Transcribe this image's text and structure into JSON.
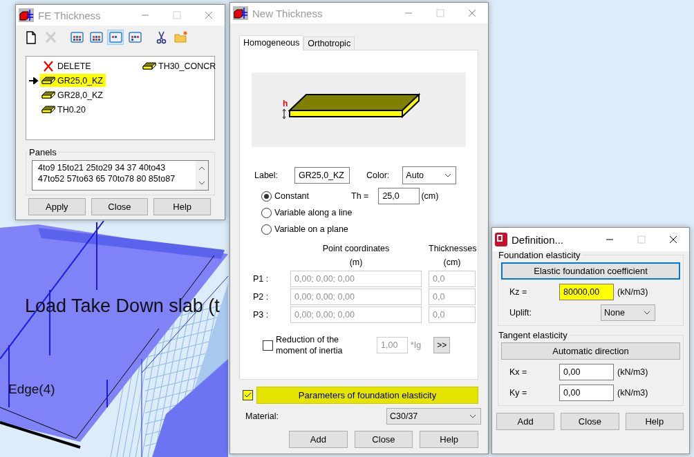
{
  "viewport": {
    "labels": [
      {
        "text": "Load Take Down slab (t",
        "kind": "large"
      },
      {
        "text": "Edge(4)",
        "kind": "small"
      }
    ]
  },
  "fe_thickness": {
    "title": "FE Thickness",
    "active": false,
    "toolbar": [
      {
        "kind": "new",
        "disabled": false,
        "selected": false
      },
      {
        "kind": "delete",
        "disabled": true,
        "selected": false
      },
      {
        "kind": "view",
        "disabled": false,
        "selected": false
      },
      {
        "kind": "view",
        "disabled": false,
        "selected": false
      },
      {
        "kind": "view",
        "disabled": false,
        "selected": true
      },
      {
        "kind": "view",
        "disabled": false,
        "selected": false
      },
      {
        "kind": "cut",
        "disabled": false,
        "selected": false
      },
      {
        "kind": "open",
        "disabled": false,
        "selected": false
      }
    ],
    "items": [
      {
        "label": "DELETE",
        "kind": "delete",
        "selected": false,
        "highlighted": false
      },
      {
        "label": "GR25,0_KZ",
        "kind": "thickness",
        "selected": true,
        "highlighted": true
      },
      {
        "label": "GR28,0_KZ",
        "kind": "thickness",
        "selected": false,
        "highlighted": false
      },
      {
        "label": "TH0.20",
        "kind": "thickness",
        "selected": false,
        "highlighted": false
      },
      {
        "label": "TH30_CONCR",
        "kind": "thickness",
        "selected": false,
        "highlighted": false
      }
    ],
    "panels": {
      "title": "Panels",
      "lines": [
        "4to9 15to21 25to29 34 37 40to43",
        "47to52 57to63 65 70to78 80 85to87"
      ]
    },
    "buttons": [
      "Apply",
      "Close",
      "Help"
    ]
  },
  "new_thickness": {
    "title": "New Thickness",
    "active": false,
    "tabs": [
      {
        "label": "Homogeneous",
        "selected": true
      },
      {
        "label": "Orthotropic",
        "selected": false
      }
    ],
    "preview": {
      "dimension_label": "h"
    },
    "label_field": {
      "label": "Label:",
      "value": "GR25,0_KZ"
    },
    "color_select": {
      "label": "Color:",
      "value": "Auto"
    },
    "modes": [
      {
        "label": "Constant",
        "selected": true
      },
      {
        "label": "Variable along a line",
        "selected": false
      },
      {
        "label": "Variable on a plane",
        "selected": false
      }
    ],
    "thickness_field": {
      "label": "Th =",
      "value": "25,0",
      "unit": "(cm)"
    },
    "points": {
      "disabled": true,
      "headers": [
        {
          "title": "Point coordinates",
          "unit": "(m)"
        },
        {
          "title": "Thicknesses",
          "unit": "(cm)"
        }
      ],
      "rows": [
        {
          "label": "P1 :",
          "coordinates": "0,00; 0,00; 0,00",
          "thickness": "0,0"
        },
        {
          "label": "P2 :",
          "coordinates": "0,00; 0,00; 0,00",
          "thickness": "0,0"
        },
        {
          "label": "P3 :",
          "coordinates": "0,00; 0,00; 0,00",
          "thickness": "0,0"
        }
      ]
    },
    "reduction": {
      "label": "Reduction of the moment of inertia",
      "checked": false,
      "value": "1,00",
      "unit": "*Ig",
      "button": ">>"
    },
    "foundation": {
      "label": "Parameters of foundation elasticity",
      "checked": true,
      "highlighted": true
    },
    "material": {
      "label": "Material:",
      "value": "C30/37"
    },
    "buttons": [
      "Add",
      "Close",
      "Help"
    ]
  },
  "definition": {
    "title": "Definition...",
    "active": true,
    "groups": [
      {
        "title": "Foundation elasticity",
        "button": {
          "label": "Elastic foundation coefficient",
          "focused": true
        },
        "fields": [
          {
            "kind": "input",
            "label": "Kz =",
            "value": "80000,00",
            "unit": "(kN/m3)",
            "highlighted": true
          },
          {
            "kind": "select",
            "label": "Uplift:",
            "value": "None"
          }
        ]
      },
      {
        "title": "Tangent elasticity",
        "button": {
          "label": "Automatic direction",
          "focused": false
        },
        "fields": [
          {
            "kind": "input",
            "label": "Kx =",
            "value": "0,00",
            "unit": "(kN/m3)",
            "highlighted": false
          },
          {
            "kind": "input",
            "label": "Ky =",
            "value": "0,00",
            "unit": "(kN/m3)",
            "highlighted": false
          }
        ]
      }
    ],
    "buttons": [
      "Add",
      "Close",
      "Help"
    ]
  }
}
